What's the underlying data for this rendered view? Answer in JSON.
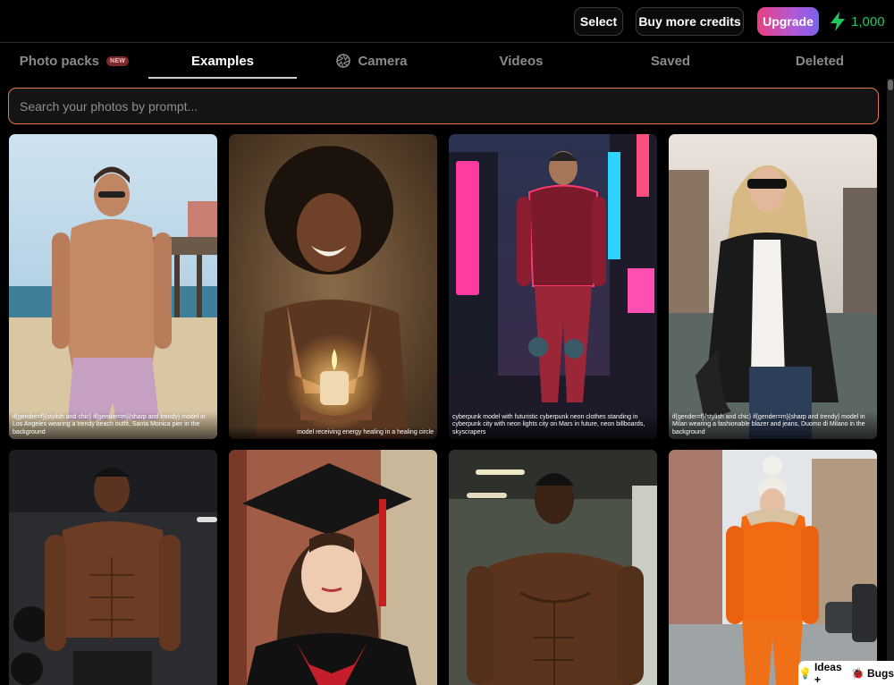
{
  "header": {
    "select_label": "Select",
    "buy_credits_label": "Buy more credits",
    "upgrade_label": "Upgrade",
    "credits_count": "1,000",
    "credits_icon": "lightning-bolt-icon",
    "credits_color": "#22c55e"
  },
  "tabs": [
    {
      "label": "Photo packs",
      "badge": "NEW",
      "active": false
    },
    {
      "label": "Examples",
      "active": true
    },
    {
      "label": "Camera",
      "icon": "aperture-icon",
      "active": false
    },
    {
      "label": "Videos",
      "active": false
    },
    {
      "label": "Saved",
      "active": false
    },
    {
      "label": "Deleted",
      "active": false
    }
  ],
  "search": {
    "placeholder": "Search your photos by prompt...",
    "value": "",
    "border_color": "#e0784a"
  },
  "photos": [
    {
      "subject": "man on beach with sunglasses by pier",
      "caption": "if{gender=f}{stylish and chic} if{gender=m}{sharp and trendy} model in Los Angeles wearing a trendy beach outfit, Santa Monica pier in the background"
    },
    {
      "subject": "smiling woman holding a candle",
      "caption": "model receiving energy healing in a healing circle"
    },
    {
      "subject": "cyberpunk man in neon jacket on city street",
      "caption": "cyberpunk model with futuristic cyberpunk neon clothes standing in cyberpunk city with neon lights city on Mars in future, neon billboards, skyscrapers"
    },
    {
      "subject": "blonde woman in blazer by canal",
      "caption": "if{gender=f}{stylish and chic} if{gender=m}{sharp and trendy} model in Milan wearing a fashionable blazer and jeans, Duomo di Milano in the background"
    },
    {
      "subject": "muscular man in gym",
      "caption": ""
    },
    {
      "subject": "woman in graduation cap and gown",
      "caption": ""
    },
    {
      "subject": "muscular man in indoor space",
      "caption": ""
    },
    {
      "subject": "woman in orange winter jacket on street",
      "caption": ""
    }
  ],
  "feedback": {
    "label": "Ideas + ",
    "label2": "Bugs",
    "icon1": "lightbulb-icon",
    "icon2": "bug-icon"
  }
}
